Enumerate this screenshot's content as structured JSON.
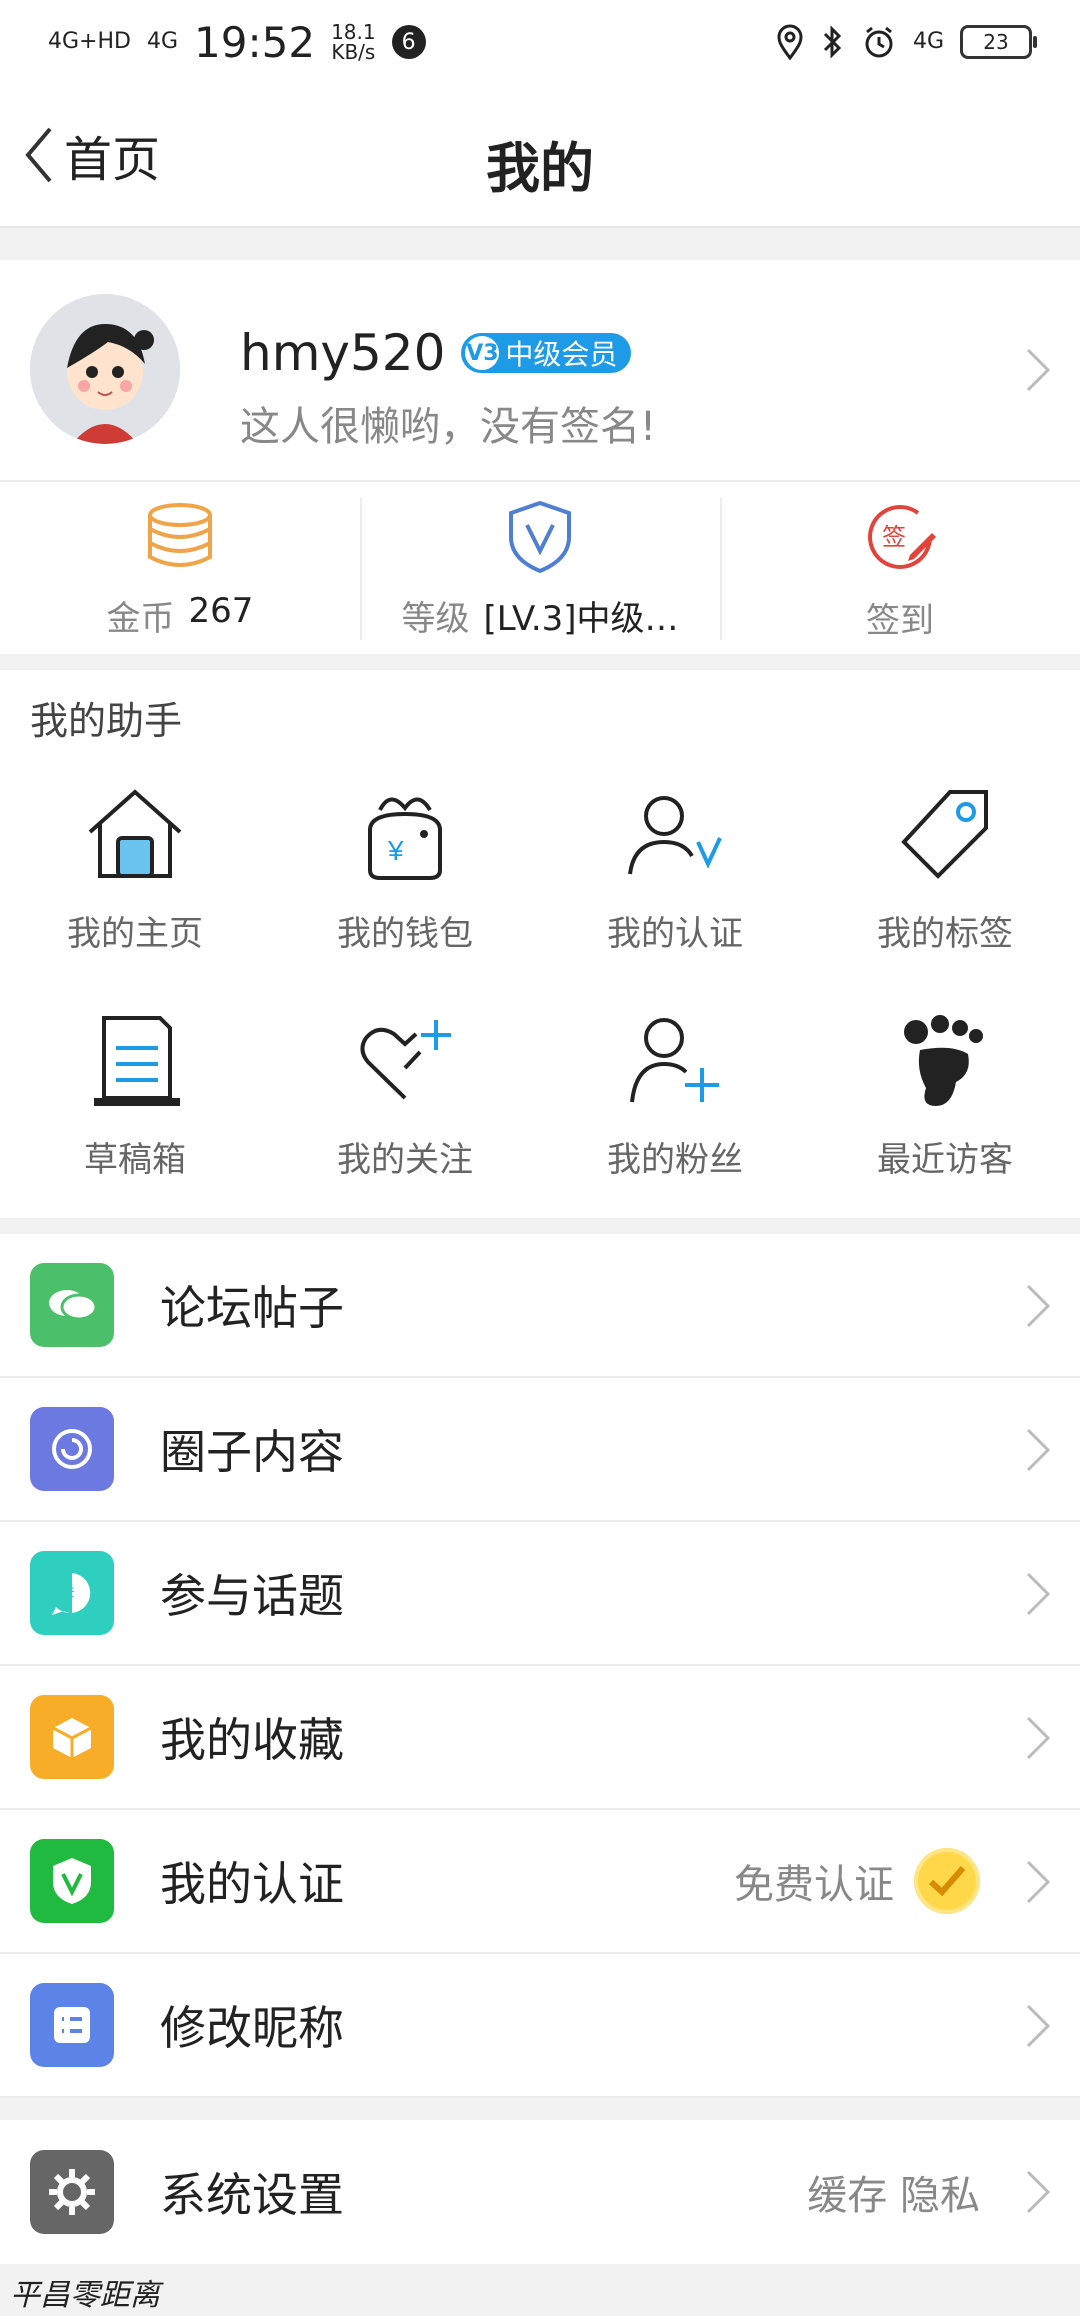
{
  "status_bar": {
    "net_1": "4G+HD",
    "net_2": "4G",
    "time": "19:52",
    "speed": "18.1",
    "speed_unit": "KB/s",
    "notification_count": "6",
    "battery": "23"
  },
  "header": {
    "back_label": "首页",
    "title": "我的"
  },
  "profile": {
    "username": "hmy520",
    "vip_badge": "中级会员",
    "vip_level": "V3",
    "signature": "这人很懒哟，没有签名!"
  },
  "stats": {
    "coins_label": "金币",
    "coins_value": "267",
    "level_label": "等级",
    "level_value": "[LV.3]中级…",
    "checkin_label": "签到"
  },
  "assistant": {
    "title": "我的助手",
    "items": [
      {
        "label": "我的主页",
        "icon": "home-icon"
      },
      {
        "label": "我的钱包",
        "icon": "wallet-icon"
      },
      {
        "label": "我的认证",
        "icon": "user-verified-icon"
      },
      {
        "label": "我的标签",
        "icon": "tag-icon"
      },
      {
        "label": "草稿箱",
        "icon": "draft-icon"
      },
      {
        "label": "我的关注",
        "icon": "heart-plus-icon"
      },
      {
        "label": "我的粉丝",
        "icon": "user-plus-icon"
      },
      {
        "label": "最近访客",
        "icon": "footprint-icon"
      }
    ]
  },
  "menu": {
    "items": [
      {
        "label": "论坛帖子",
        "icon": "chat-icon",
        "color": "#4cbf6a"
      },
      {
        "label": "圈子内容",
        "icon": "circle-icon",
        "color": "#6b79e1"
      },
      {
        "label": "参与话题",
        "icon": "topic-icon",
        "color": "#2fcfbf"
      },
      {
        "label": "我的收藏",
        "icon": "box-icon",
        "color": "#f7ad28"
      },
      {
        "label": "我的认证",
        "icon": "shield-v-icon",
        "color": "#1fba3f",
        "right_text": "免费认证"
      },
      {
        "label": "修改昵称",
        "icon": "list-icon",
        "color": "#5b83e8"
      }
    ],
    "settings": {
      "label": "系统设置",
      "icon": "gear-icon",
      "color": "#666666",
      "right_text": "缓存 隐私"
    }
  },
  "footer": {
    "watermark": "平昌零距离"
  }
}
